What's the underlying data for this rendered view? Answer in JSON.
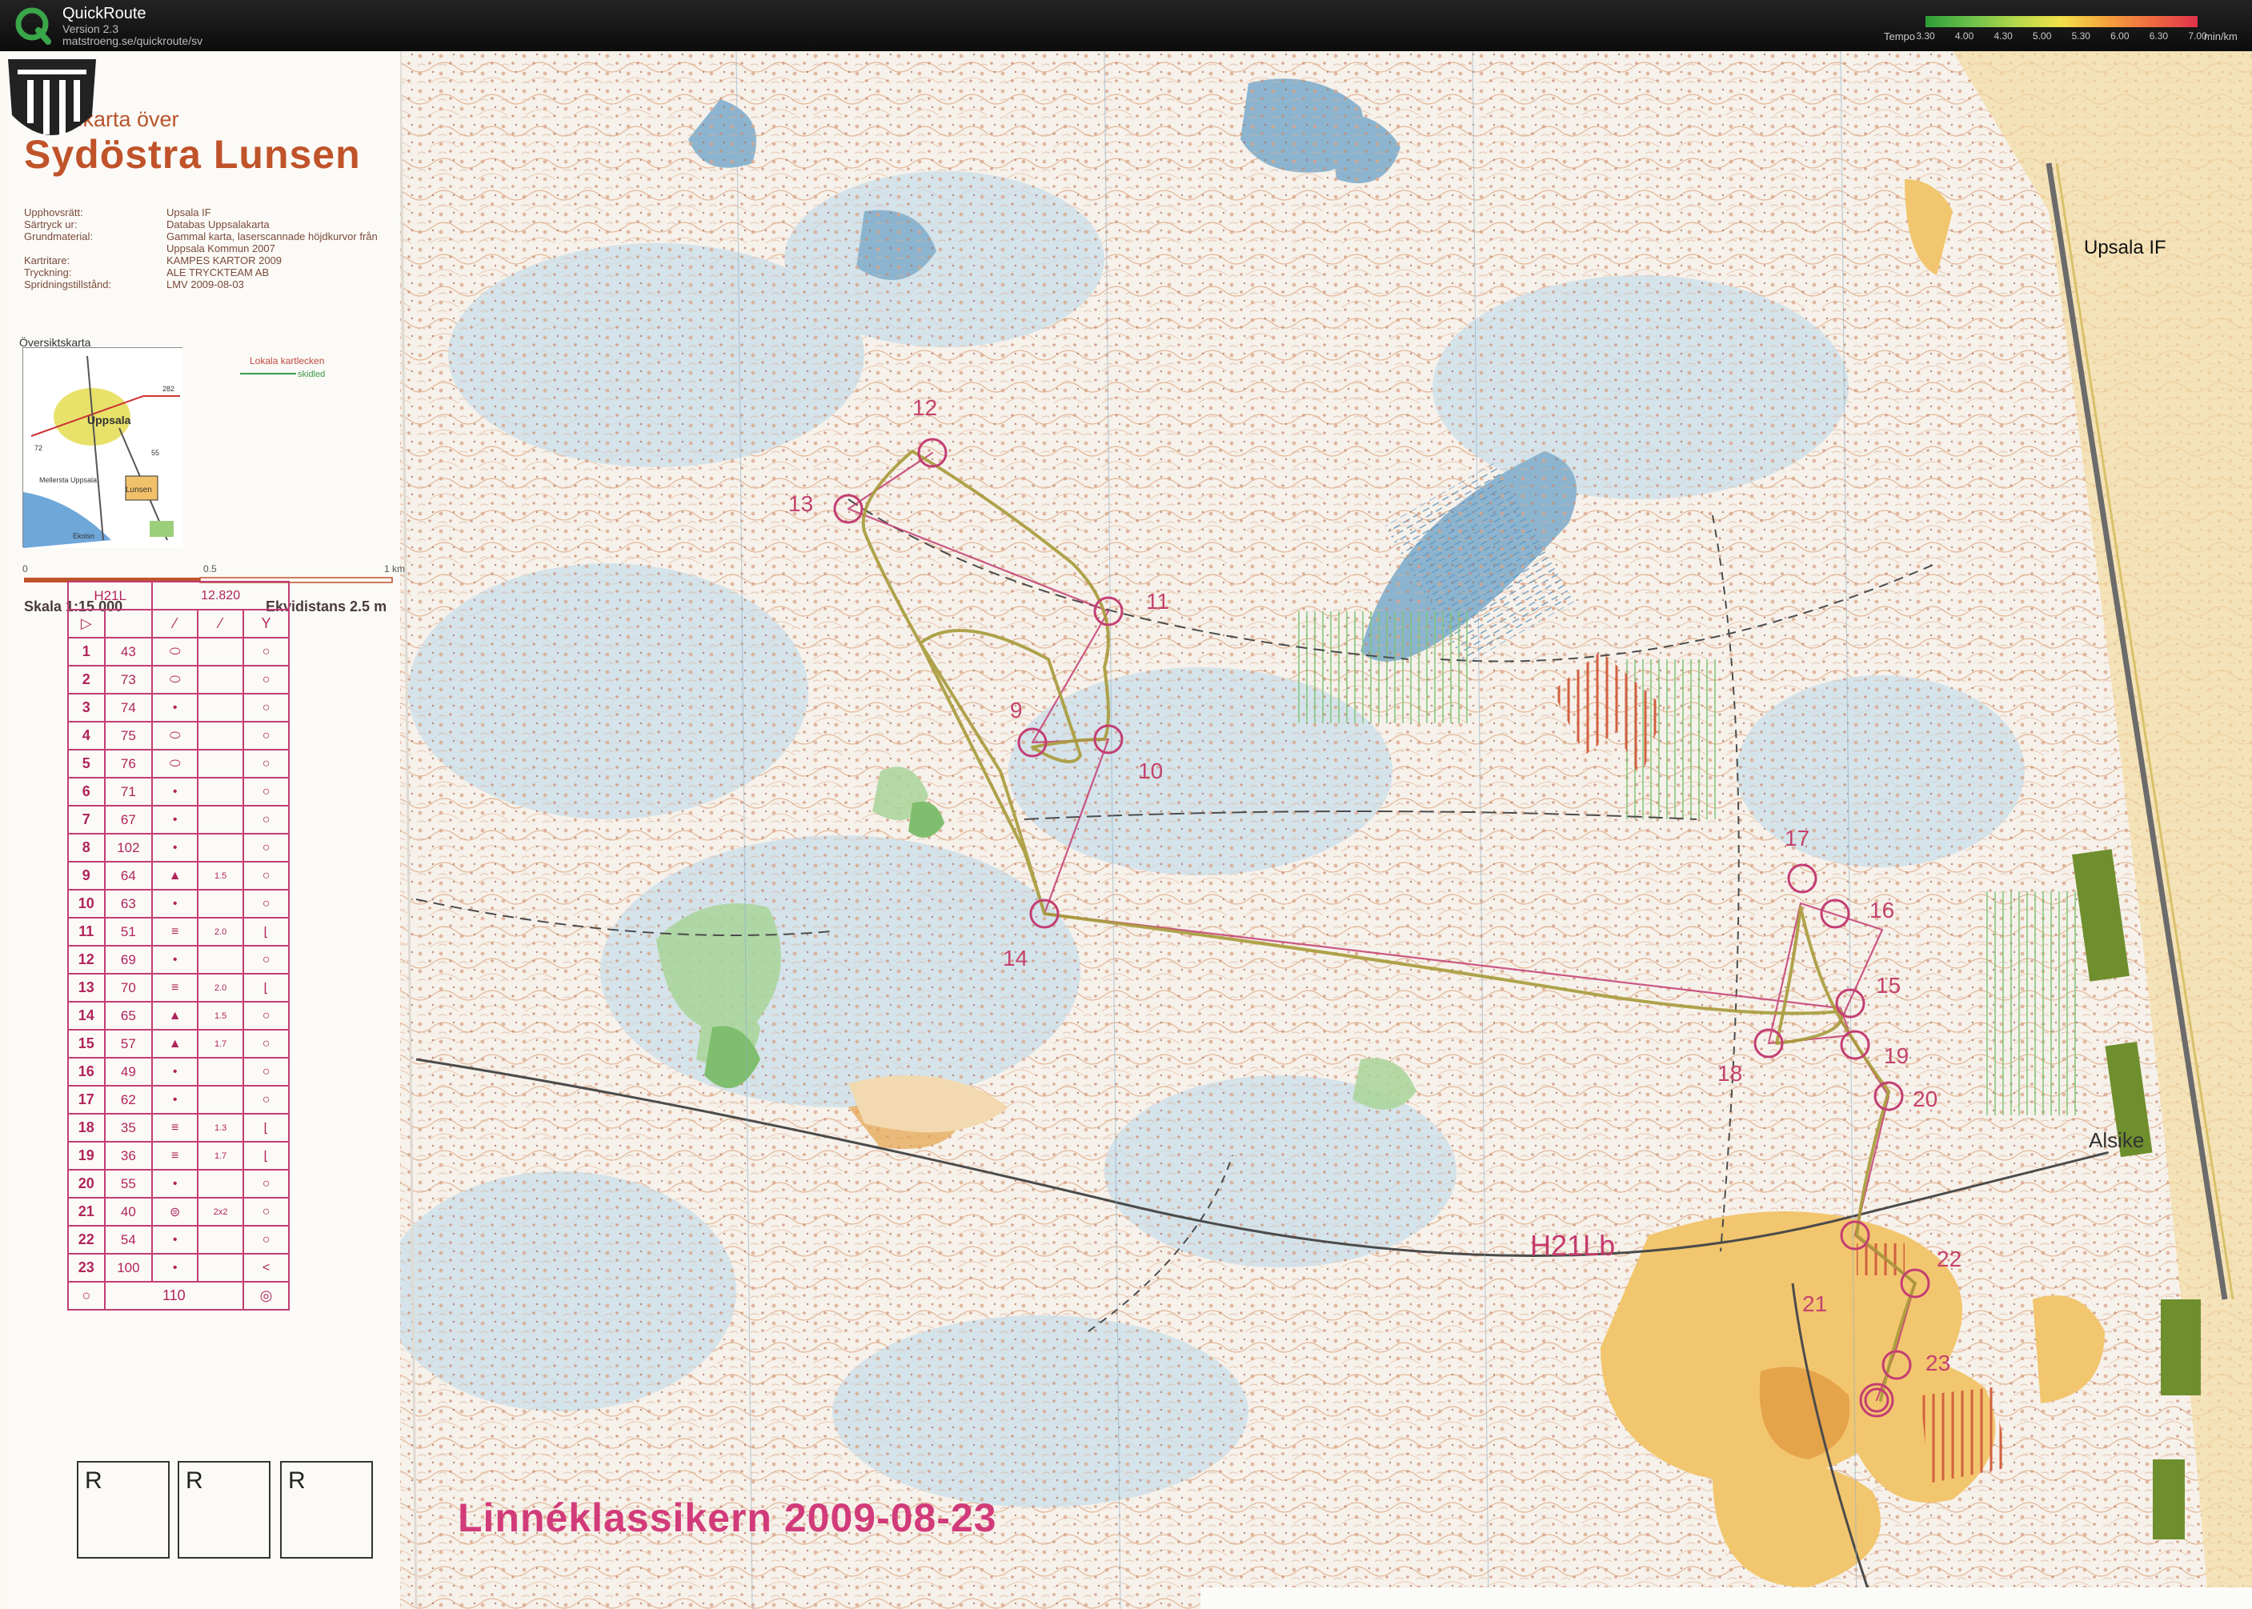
{
  "app": {
    "title": "QuickRoute",
    "version": "Version 2.3",
    "url": "matstroeng.se/quickroute/sv"
  },
  "tempo_legend": {
    "label": "Tempo",
    "ticks": [
      "3.30",
      "4.00",
      "4.30",
      "5.00",
      "5.30",
      "6.00",
      "6.30",
      "7.00"
    ],
    "unit": "min/km",
    "colors": [
      "#2d9e38",
      "#6cc14a",
      "#b4d84a",
      "#f3e04a",
      "#f5a23c",
      "#ef6a40",
      "#e2334a"
    ]
  },
  "map": {
    "subtitle": "Fritidskarta över",
    "title": "Sydöstra Lunsen",
    "metadata": [
      {
        "key": "Upphovsrätt:",
        "value": "Upsala IF"
      },
      {
        "key": "Särtryck ur:",
        "value": "Databas Uppsalakarta"
      },
      {
        "key": "Grundmaterial:",
        "value": "Gammal karta, laserscannade höjdkurvor från"
      },
      {
        "key": "",
        "value": "Uppsala Kommun 2007"
      },
      {
        "key": "Kartritare:",
        "value": "KAMPES KARTOR 2009"
      },
      {
        "key": "Tryckning:",
        "value": "ALE TRYCKTEAM AB"
      },
      {
        "key": "Spridningstillstånd:",
        "value": "LMV 2009-08-03"
      }
    ],
    "inset": {
      "title": "Översiktskarta",
      "legend_local": "Lokala kartlecken",
      "legend_trail": "skidled",
      "places": [
        "Uppsala",
        "Lunsen",
        "Ekolsn",
        "Mellersta Uppsala"
      ],
      "roads": [
        "72",
        "282",
        "55"
      ]
    },
    "scale": {
      "label": "Skala 1:15 000",
      "contour": "Ekvidistans 2.5 m",
      "ticks": [
        "0",
        "0.5",
        "1 km"
      ]
    },
    "event_title": "Linnéklassikern 2009-08-23",
    "course_name": "H21Lb",
    "place_alsike": "Alsike",
    "club": "Upsala IF",
    "r_boxes": [
      "R",
      "R",
      "R"
    ]
  },
  "control_descriptions": {
    "class": "H21L",
    "length": "12.820",
    "finish_distance": "110",
    "rows": [
      {
        "n": "1",
        "code": "43",
        "feature": "⬭",
        "dim": "",
        "loc": "○"
      },
      {
        "n": "2",
        "code": "73",
        "feature": "⬭",
        "dim": "",
        "loc": "○"
      },
      {
        "n": "3",
        "code": "74",
        "feature": "•",
        "dim": "",
        "loc": "○"
      },
      {
        "n": "4",
        "code": "75",
        "feature": "⬭",
        "dim": "",
        "loc": "○"
      },
      {
        "n": "5",
        "code": "76",
        "feature": "⬭",
        "dim": "",
        "loc": "○"
      },
      {
        "n": "6",
        "code": "71",
        "feature": "•",
        "dim": "",
        "loc": "○"
      },
      {
        "n": "7",
        "code": "67",
        "feature": "•",
        "dim": "",
        "loc": "○"
      },
      {
        "n": "8",
        "code": "102",
        "feature": "•",
        "dim": "",
        "loc": "○"
      },
      {
        "n": "9",
        "code": "64",
        "feature": "▲",
        "dim": "1.5",
        "loc": "○"
      },
      {
        "n": "10",
        "code": "63",
        "feature": "•",
        "dim": "",
        "loc": "○"
      },
      {
        "n": "11",
        "code": "51",
        "feature": "≡",
        "dim": "2.0",
        "loc": "⌊"
      },
      {
        "n": "12",
        "code": "69",
        "feature": "•",
        "dim": "",
        "loc": "○"
      },
      {
        "n": "13",
        "code": "70",
        "feature": "≡",
        "dim": "2.0",
        "loc": "⌊"
      },
      {
        "n": "14",
        "code": "65",
        "feature": "▲",
        "dim": "1.5",
        "loc": "○"
      },
      {
        "n": "15",
        "code": "57",
        "feature": "▲",
        "dim": "1.7",
        "loc": "○"
      },
      {
        "n": "16",
        "code": "49",
        "feature": "•",
        "dim": "",
        "loc": "○"
      },
      {
        "n": "17",
        "code": "62",
        "feature": "•",
        "dim": "",
        "loc": "○"
      },
      {
        "n": "18",
        "code": "35",
        "feature": "≡",
        "dim": "1.3",
        "loc": "⌊"
      },
      {
        "n": "19",
        "code": "36",
        "feature": "≡",
        "dim": "1.7",
        "loc": "⌊"
      },
      {
        "n": "20",
        "code": "55",
        "feature": "•",
        "dim": "",
        "loc": "○"
      },
      {
        "n": "21",
        "code": "40",
        "feature": "⊜",
        "dim": "2x2",
        "loc": "○"
      },
      {
        "n": "22",
        "code": "54",
        "feature": "•",
        "dim": "",
        "loc": "○"
      },
      {
        "n": "23",
        "code": "100",
        "feature": "•",
        "dim": "",
        "loc": "<"
      }
    ]
  },
  "controls": [
    {
      "label": "12"
    },
    {
      "label": "13"
    },
    {
      "label": "11"
    },
    {
      "label": "9"
    },
    {
      "label": "10"
    },
    {
      "label": "14"
    },
    {
      "label": "17"
    },
    {
      "label": "16"
    },
    {
      "label": "15"
    },
    {
      "label": "18"
    },
    {
      "label": "19"
    },
    {
      "label": "20"
    },
    {
      "label": "22"
    },
    {
      "label": "21"
    },
    {
      "label": "23"
    }
  ],
  "colors": {
    "course": "#c33d73",
    "route": "#9a8f3a",
    "forest_light": "#dfeee0",
    "marsh_blue": "#c7dce8",
    "open_land": "#f0c36a",
    "road": "#4a4a4a"
  }
}
